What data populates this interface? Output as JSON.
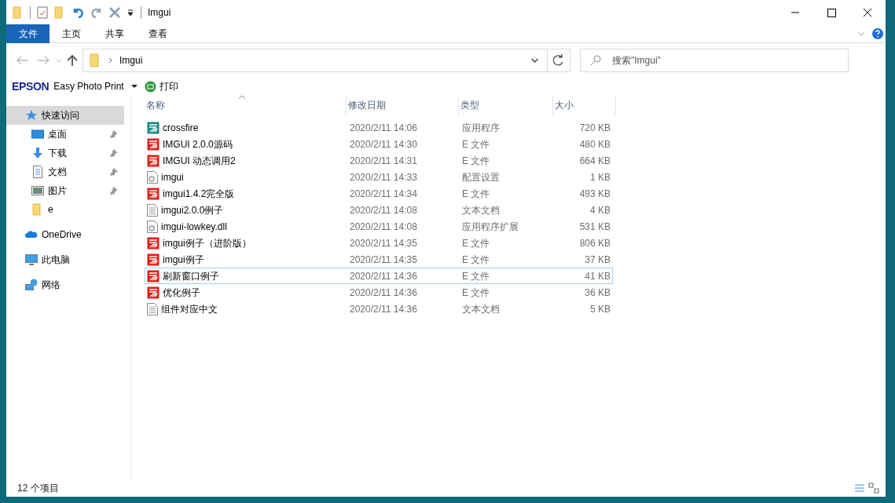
{
  "window": {
    "title": "Imgui"
  },
  "ribbon_tabs": [
    {
      "label": "文件",
      "selected": true
    },
    {
      "label": "主页",
      "selected": false
    },
    {
      "label": "共享",
      "selected": false
    },
    {
      "label": "查看",
      "selected": false
    }
  ],
  "address": {
    "path": "Imgui"
  },
  "search": {
    "placeholder": "搜索\"Imgui\""
  },
  "epson_bar": {
    "brand": "EPSON",
    "app": "Easy Photo Print",
    "print": "打印"
  },
  "sidebar": {
    "items": [
      {
        "label": "快速访问",
        "kind": "quick",
        "selected": true,
        "pinned": false,
        "children": [
          {
            "label": "桌面",
            "kind": "desktop",
            "selected": false,
            "pinned": true
          },
          {
            "label": "下载",
            "kind": "download",
            "selected": false,
            "pinned": true
          },
          {
            "label": "文档",
            "kind": "document",
            "selected": false,
            "pinned": true
          },
          {
            "label": "图片",
            "kind": "picture",
            "selected": false,
            "pinned": true
          },
          {
            "label": "e",
            "kind": "folder",
            "selected": false,
            "pinned": false
          }
        ]
      },
      {
        "label": "OneDrive",
        "kind": "cloud",
        "selected": false,
        "pinned": false
      },
      {
        "label": "此电脑",
        "kind": "pc",
        "selected": false,
        "pinned": false
      },
      {
        "label": "网络",
        "kind": "network",
        "selected": false,
        "pinned": false
      }
    ]
  },
  "table": {
    "columns": [
      "名称",
      "修改日期",
      "类型",
      "大小"
    ],
    "rows": [
      {
        "kind": "app",
        "name": "crossfire",
        "date": "2020/2/11 14:06",
        "type": "应用程序",
        "size": "720 KB",
        "focused": false
      },
      {
        "kind": "e",
        "name": "IMGUI 2.0.0源码",
        "date": "2020/2/11 14:30",
        "type": "E 文件",
        "size": "480 KB",
        "focused": false
      },
      {
        "kind": "e",
        "name": "IMGUI 动态调用2",
        "date": "2020/2/11 14:31",
        "type": "E 文件",
        "size": "664 KB",
        "focused": false
      },
      {
        "kind": "config",
        "name": "imgui",
        "date": "2020/2/11 14:33",
        "type": "配置设置",
        "size": "1 KB",
        "focused": false
      },
      {
        "kind": "e",
        "name": "imgui1.4.2完全版",
        "date": "2020/2/11 14:34",
        "type": "E 文件",
        "size": "493 KB",
        "focused": false
      },
      {
        "kind": "text",
        "name": "imgui2.0.0例子",
        "date": "2020/2/11 14:08",
        "type": "文本文档",
        "size": "4 KB",
        "focused": false
      },
      {
        "kind": "dll",
        "name": "imgui-lowkey.dll",
        "date": "2020/2/11 14:08",
        "type": "应用程序扩展",
        "size": "531 KB",
        "focused": false
      },
      {
        "kind": "e",
        "name": "imgui例子（进阶版）",
        "date": "2020/2/11 14:35",
        "type": "E 文件",
        "size": "806 KB",
        "focused": false
      },
      {
        "kind": "e",
        "name": "imgui例子",
        "date": "2020/2/11 14:35",
        "type": "E 文件",
        "size": "37 KB",
        "focused": false
      },
      {
        "kind": "e",
        "name": "刷新窗口例子",
        "date": "2020/2/11 14:36",
        "type": "E 文件",
        "size": "41 KB",
        "focused": true
      },
      {
        "kind": "e",
        "name": "优化例子",
        "date": "2020/2/11 14:36",
        "type": "E 文件",
        "size": "36 KB",
        "focused": false
      },
      {
        "kind": "text",
        "name": "组件对应中文",
        "date": "2020/2/11 14:36",
        "type": "文本文档",
        "size": "5 KB",
        "focused": false
      }
    ]
  },
  "status_bar": {
    "count": "12 个项目"
  }
}
